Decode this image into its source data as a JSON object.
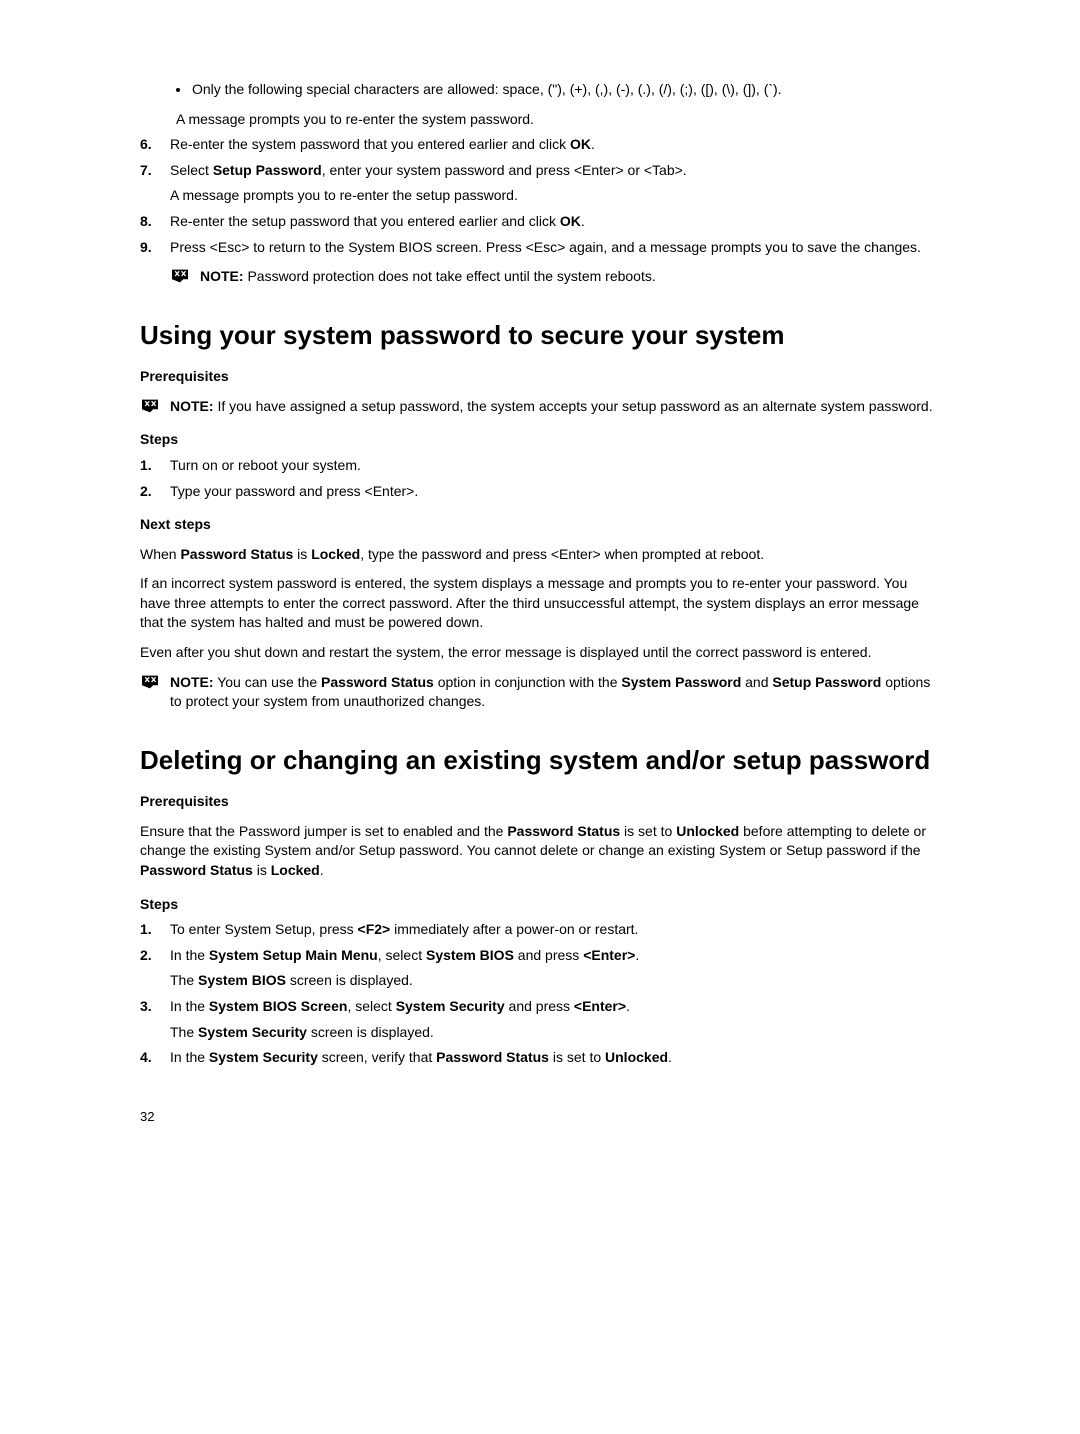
{
  "top_bullet": "Only the following special characters are allowed: space, (\"), (+), (,), (-), (.), (/), (;), ([), (\\), (]), (`).",
  "line_after_bullet": "A message prompts you to re-enter the system password.",
  "steps_top": [
    {
      "n": "6.",
      "text": "Re-enter the system password that you entered earlier and click ",
      "bold_end": "OK",
      "tail": "."
    },
    {
      "n": "7.",
      "lead": "Select ",
      "bold1": "Setup Password",
      "mid": ", enter your system password and press <Enter> or <Tab>.",
      "second_line": "A message prompts you to re-enter the setup password."
    },
    {
      "n": "8.",
      "text": "Re-enter the setup password that you entered earlier and click ",
      "bold_end": "OK",
      "tail": "."
    },
    {
      "n": "9.",
      "text": "Press <Esc> to return to the System BIOS screen. Press <Esc> again, and a message prompts you to save the changes."
    }
  ],
  "note1": {
    "label": "NOTE:",
    "text": " Password protection does not take effect until the system reboots."
  },
  "h1_a": "Using your system password to secure your system",
  "prereq_label": "Prerequisites",
  "note2": {
    "label": "NOTE:",
    "text": " If you have assigned a setup password, the system accepts your setup password as an alternate system password."
  },
  "steps_label": "Steps",
  "steps_mid": [
    {
      "n": "1.",
      "text": "Turn on or reboot your system."
    },
    {
      "n": "2.",
      "text": "Type your password and press <Enter>."
    }
  ],
  "next_steps_label": "Next steps",
  "next_steps_line": {
    "pre": "When ",
    "b1": "Password Status",
    "mid": " is ",
    "b2": "Locked",
    "post": ", type the password and press <Enter> when prompted at reboot."
  },
  "para1": "If an incorrect system password is entered, the system displays a message and prompts you to re-enter your password. You have three attempts to enter the correct password. After the third unsuccessful attempt, the system displays an error message that the system has halted and must be powered down.",
  "para2": "Even after you shut down and restart the system, the error message is displayed until the correct password is entered.",
  "note3": {
    "label": "NOTE:",
    "pre": " You can use the ",
    "b1": "Password Status",
    "mid": " option in conjunction with the ",
    "b2": "System Password",
    "mid2": " and ",
    "b3": "Setup Password",
    "post": " options to protect your system from unauthorized changes."
  },
  "h1_b": "Deleting or changing an existing system and/or setup password",
  "prereq_text": {
    "pre": "Ensure that the Password jumper is set to enabled and the ",
    "b1": "Password Status",
    "mid": " is set to ",
    "b2": "Unlocked",
    "mid2": " before attempting to delete or change the existing System and/or Setup password. You cannot delete or change an existing System or Setup password if the ",
    "b3": "Password Status",
    "mid3": " is ",
    "b4": "Locked",
    "post": "."
  },
  "steps_bot": [
    {
      "n": "1.",
      "pre": "To enter System Setup, press ",
      "b1": "<F2>",
      "post": " immediately after a power-on or restart."
    },
    {
      "n": "2.",
      "pre": "In the ",
      "b1": "System Setup Main Menu",
      "mid": ", select ",
      "b2": "System BIOS",
      "mid2": " and press ",
      "b3": "<Enter>",
      "post": ".",
      "second_line_pre": "The ",
      "second_line_b": "System BIOS",
      "second_line_post": " screen is displayed."
    },
    {
      "n": "3.",
      "pre": "In the ",
      "b1": "System BIOS Screen",
      "mid": ", select ",
      "b2": "System Security",
      "mid2": " and press ",
      "b3": "<Enter>",
      "post": ".",
      "second_line_pre": "The ",
      "second_line_b": "System Security",
      "second_line_post": " screen is displayed."
    },
    {
      "n": "4.",
      "pre": "In the ",
      "b1": "System Security",
      "mid": " screen, verify that ",
      "b2": "Password Status",
      "mid2": " is set to ",
      "b3": "Unlocked",
      "post": "."
    }
  ],
  "page_num": "32"
}
